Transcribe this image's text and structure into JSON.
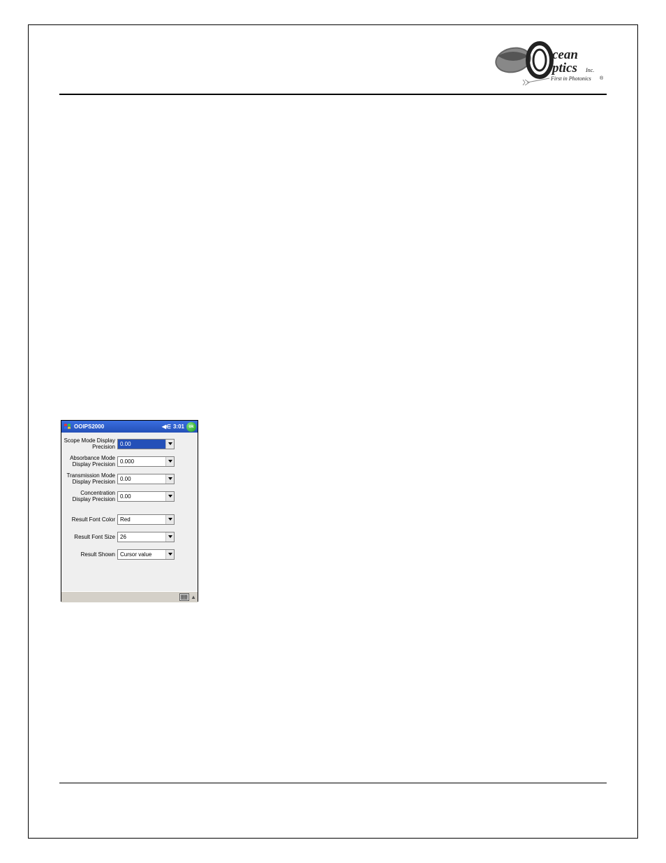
{
  "logo": {
    "line1": "cean",
    "line2": "ptics",
    "suffix": "Inc.",
    "tagline": "First in Photonics"
  },
  "pda": {
    "title": "OOIPS2000",
    "time": "3:01",
    "ok": "ok",
    "rows": [
      {
        "label": "Scope Mode Display Precision",
        "value": "0.00",
        "selected": true
      },
      {
        "label": "Absorbance Mode Display Precision",
        "value": "0.000",
        "selected": false
      },
      {
        "label": "Transmission Mode Display Precision",
        "value": "0.00",
        "selected": false
      },
      {
        "label": "Concentration Display Precision",
        "value": "0.00",
        "selected": false
      }
    ],
    "rows2": [
      {
        "label": "Result Font Color",
        "value": "Red"
      },
      {
        "label": "Result Font Size",
        "value": "26"
      },
      {
        "label": "Result Shown",
        "value": "Cursor value"
      }
    ]
  }
}
